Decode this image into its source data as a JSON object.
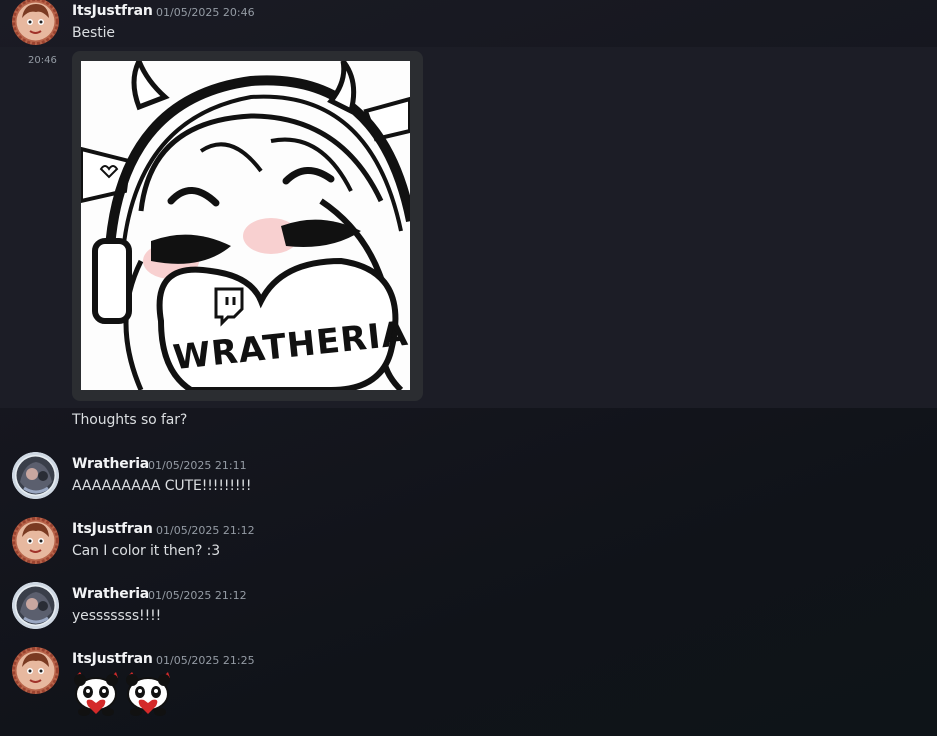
{
  "messages": [
    {
      "author": "ItsJustfran",
      "timestamp": "01/05/2025 20:46",
      "text": "Bestie"
    },
    {
      "side_time": "20:46",
      "attachment": "image"
    },
    {
      "text": "Thoughts so far?"
    },
    {
      "author": "Wratheria",
      "timestamp": "01/05/2025 21:11",
      "text": "AAAAAAAAA CUTE!!!!!!!!!"
    },
    {
      "author": "ItsJustfran",
      "timestamp": "01/05/2025 21:12",
      "text": "Can I color it then? :3"
    },
    {
      "author": "Wratheria",
      "timestamp": "01/05/2025 21:12",
      "text": "yesssssss!!!!"
    },
    {
      "author": "ItsJustfran",
      "timestamp": "01/05/2025 21:25",
      "emojis": [
        "panda-heart-emoji",
        "panda-heart-emoji"
      ]
    }
  ],
  "artwork": {
    "watermark_text": "WRATHERIA",
    "icon": "twitch-icon"
  },
  "colors": {
    "background": "#15161e",
    "hover_background": "#1c1d26",
    "username": "#f2f3f5",
    "timestamp": "#949ba4",
    "text": "#dbdee1"
  }
}
